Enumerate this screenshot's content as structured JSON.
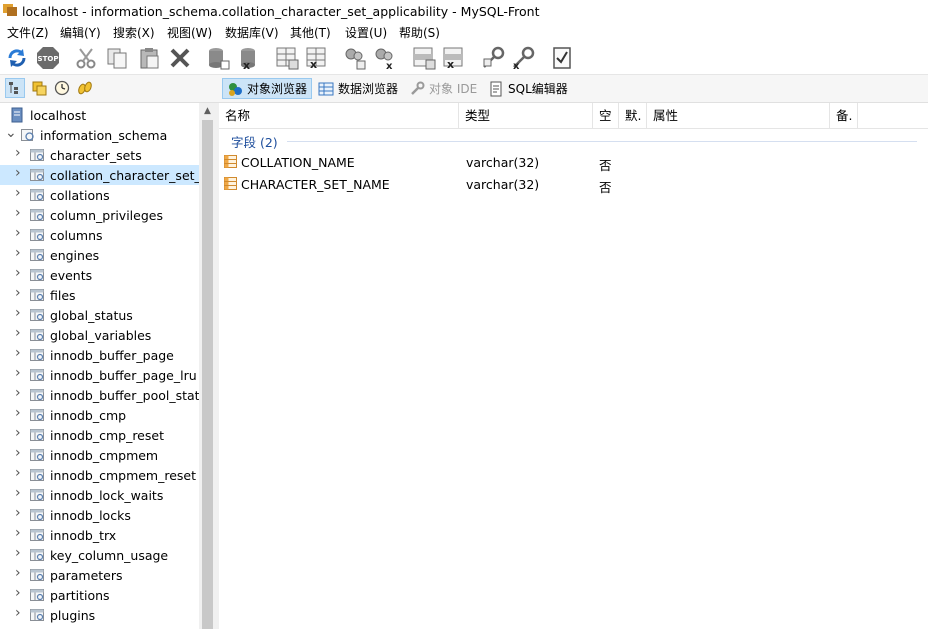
{
  "window": {
    "title": "localhost - information_schema.collation_character_set_applicability - MySQL-Front"
  },
  "menu": [
    {
      "label": "文件(Z)"
    },
    {
      "label": "编辑(Y)"
    },
    {
      "label": "搜索(X)"
    },
    {
      "label": "视图(W)"
    },
    {
      "label": "数据库(V)"
    },
    {
      "label": "其他(T)"
    },
    {
      "label": "设置(U)"
    },
    {
      "label": "帮助(S)"
    }
  ],
  "toolbar": {
    "icons": [
      "refresh-icon",
      "stop-icon",
      "cut-icon",
      "copy-icon",
      "paste-icon",
      "delete-icon",
      "database-add-icon",
      "database-delete-icon",
      "table-add-icon",
      "table-delete-icon",
      "user-add-icon",
      "user-delete-icon",
      "field-add-icon",
      "field-delete-icon",
      "key-add-icon",
      "key-delete-icon",
      "checklist-icon"
    ]
  },
  "views": {
    "object_browser": "对象浏览器",
    "data_browser": "数据浏览器",
    "object_ide": "对象 IDE",
    "sql_editor": "SQL编辑器"
  },
  "tree": {
    "host": "localhost",
    "database": "information_schema",
    "tables": [
      "character_sets",
      "collation_character_set_ap",
      "collations",
      "column_privileges",
      "columns",
      "engines",
      "events",
      "files",
      "global_status",
      "global_variables",
      "innodb_buffer_page",
      "innodb_buffer_page_lru",
      "innodb_buffer_pool_stats",
      "innodb_cmp",
      "innodb_cmp_reset",
      "innodb_cmpmem",
      "innodb_cmpmem_reset",
      "innodb_lock_waits",
      "innodb_locks",
      "innodb_trx",
      "key_column_usage",
      "parameters",
      "partitions",
      "plugins"
    ],
    "selected_index": 1
  },
  "list": {
    "columns": {
      "name": "名称",
      "type": "类型",
      "null": "空",
      "default": "默.",
      "attributes": "属性",
      "comment": "备."
    },
    "group_label": "字段 (2)",
    "rows": [
      {
        "name": "COLLATION_NAME",
        "type": "varchar(32)",
        "null": "否"
      },
      {
        "name": "CHARACTER_SET_NAME",
        "type": "varchar(32)",
        "null": "否"
      }
    ]
  },
  "colors": {
    "selection": "#cce8ff",
    "group_text": "#1e4e9c",
    "active_tab": "#cce4f7"
  }
}
